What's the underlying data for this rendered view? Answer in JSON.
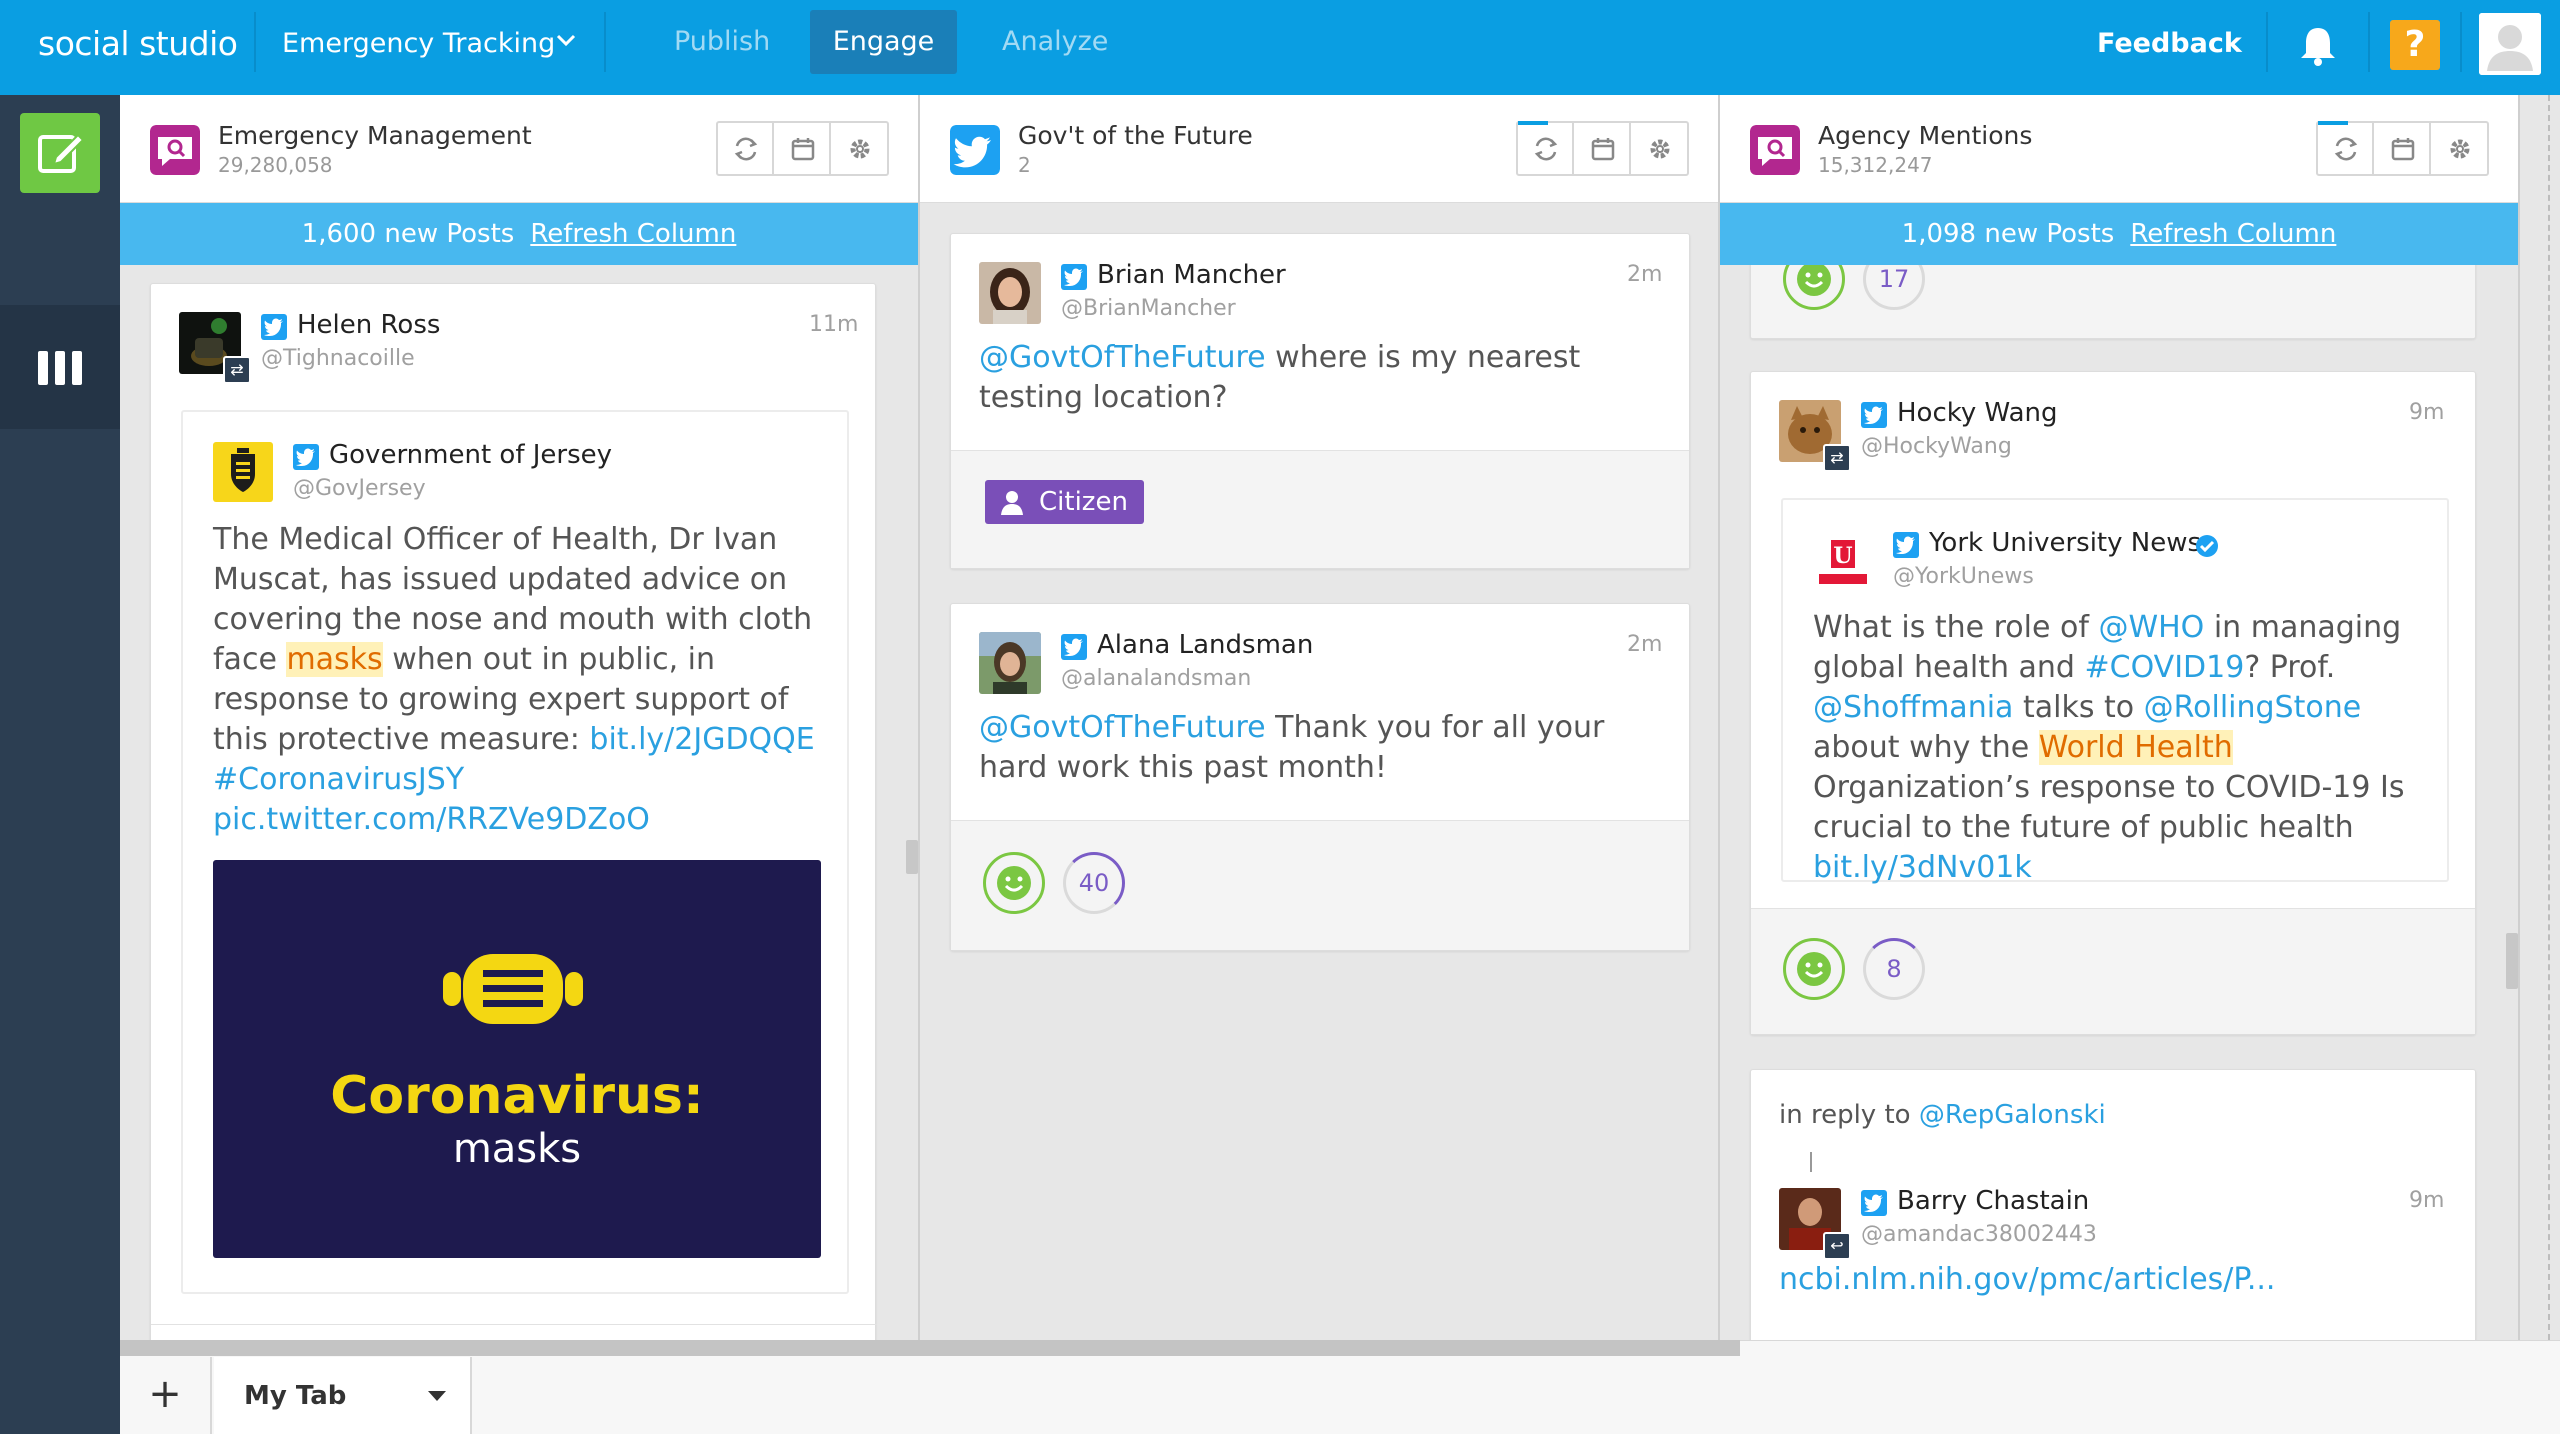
{
  "topbar": {
    "logo": "social studio",
    "workspace": "Emergency Tracking",
    "nav": [
      "Publish",
      "Engage",
      "Analyze"
    ],
    "feedback": "Feedback",
    "help": "?"
  },
  "columns": [
    {
      "title": "Emergency Management",
      "count": "29,280,058",
      "new_posts": "1,600 new Posts",
      "refresh": "Refresh Column",
      "posts": [
        {
          "name": "Helen Ross",
          "handle": "@Tighnacoille",
          "time": "11m",
          "quoted": {
            "name": "Government of Jersey",
            "handle": "@GovJersey",
            "body_1": "The Medical Officer of Health, Dr Ivan Muscat, has issued updated advice on covering the nose and mouth with cloth face ",
            "highlight": "masks",
            "body_2": " when out in public, in response to growing expert support of this protective measure: ",
            "link_1": "bit.ly/2JGDQQE",
            "link_2": "#CoronavirusJSY",
            "link_3": "pic.twitter.com/RRZVe9DZoO",
            "image_title": "Coronavirus:",
            "image_sub": "masks"
          }
        }
      ]
    },
    {
      "title": "Gov't of the Future",
      "count": "2",
      "posts": [
        {
          "name": "Brian Mancher",
          "handle": "@BrianMancher",
          "time": "2m",
          "mention": "@GovtOfTheFuture",
          "body": " where is my nearest testing location?",
          "tag": "Citizen"
        },
        {
          "name": "Alana Landsman",
          "handle": "@alanalandsman",
          "time": "2m",
          "mention": "@GovtOfTheFuture",
          "body": " Thank you for all your hard work this past month!",
          "score": "40"
        }
      ]
    },
    {
      "title": "Agency Mentions",
      "count": "15,312,247",
      "new_posts": "1,098 new Posts",
      "refresh": "Refresh Column",
      "partial_score": "17",
      "posts": [
        {
          "name": "Hocky Wang",
          "handle": "@HockyWang",
          "time": "9m",
          "score": "8",
          "quoted": {
            "name": "York University News",
            "handle": "@YorkUnews",
            "t1": "What is the role of ",
            "l1": "@WHO",
            "t2": " in managing global health and ",
            "l2": "#COVID19",
            "t3": "? Prof. ",
            "l3": "@Shoffmania",
            "t4": " talks to ",
            "l4": "@RollingStone",
            "t5": " about why the ",
            "hl": "World Health",
            "t6": " Organization’s response to COVID-19 Is crucial to the future of public health ",
            "l5": "bit.ly/3dNv01k"
          }
        },
        {
          "reply_prefix": "in reply to ",
          "reply_handle": "@RepGalonski",
          "name": "Barry Chastain",
          "handle": "@amandac38002443",
          "time": "9m",
          "link": "ncbi.nlm.nih.gov/pmc/articles/P..."
        }
      ]
    }
  ],
  "bottom": {
    "add": "+",
    "tab": "My Tab"
  },
  "colors": {
    "brand_blue": "#0a9ee2",
    "rail": "#2c3e52",
    "compose_green": "#6fc844",
    "link": "#2aa0e0",
    "highlight": "#e06c00",
    "citizen": "#7a4fb8",
    "help": "#f7a81b"
  },
  "icons": {
    "workspace_toggle": "chevron-down-icon",
    "notifications": "bell-icon",
    "compose": "compose-icon",
    "columns_view": "columns-icon",
    "column_refresh": "refresh-icon",
    "column_calendar": "calendar-icon",
    "column_settings": "gear-icon",
    "network": "twitter-icon",
    "retweet": "retweet-icon",
    "reply": "reply-icon",
    "verified": "verified-icon",
    "sentiment": "smiley-icon",
    "tag": "person-icon"
  }
}
